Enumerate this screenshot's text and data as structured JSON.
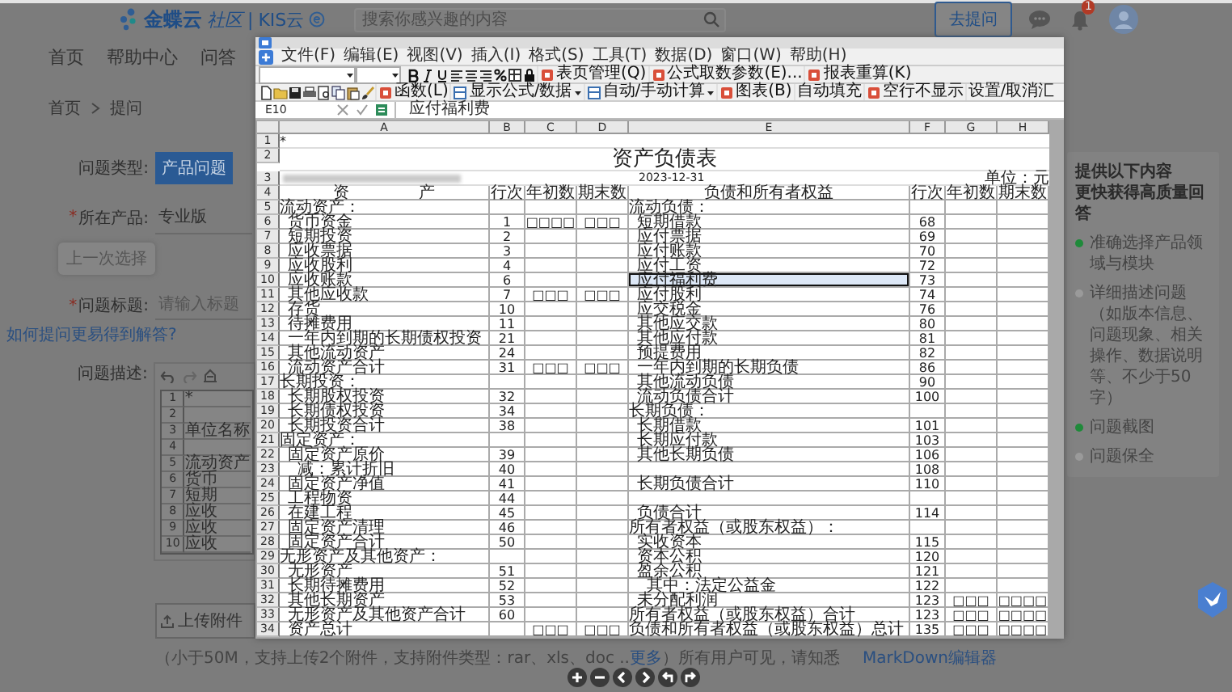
{
  "header": {
    "logo_brand": "金蝶云",
    "logo_community": "社区",
    "logo_divider": "|",
    "logo_product": "KIS云",
    "search": {
      "placeholder": "搜索你感兴趣的内容"
    },
    "ask_button": "去提问",
    "notification_count": "1"
  },
  "nav": [
    "首页",
    "帮助中心",
    "问答"
  ],
  "breadcrumb": [
    "首页",
    "提问"
  ],
  "form": {
    "question_type": {
      "label": "问题类型:",
      "options": [
        {
          "label": "产品问题",
          "selected": true
        }
      ]
    },
    "product": {
      "required_mark": "*",
      "label": "所在产品:",
      "value": "专业版",
      "tooltip": "上一次选择"
    },
    "title": {
      "required_mark": "*",
      "label": "问题标题:",
      "placeholder": "请输入标题"
    },
    "help_link": "如何提问更易得到解答?",
    "description": {
      "label": "问题描述:",
      "thumbnail_rows": [
        {
          "n": "1",
          "text": "*"
        },
        {
          "n": "2"
        },
        {
          "n": "3",
          "text": "单位名称"
        },
        {
          "n": "4"
        },
        {
          "n": "5",
          "text": "流动资产"
        },
        {
          "n": "6",
          "text": "货币"
        },
        {
          "n": "7",
          "text": "短期"
        },
        {
          "n": "8",
          "text": "应收"
        },
        {
          "n": "9",
          "text": "应收"
        },
        {
          "n": "10",
          "text": "应收"
        }
      ]
    },
    "upload_button": "上传附件",
    "note": {
      "before": "（小于50M，支持上传2个附件，支持附件类型：rar、xls、doc ..",
      "link": "更多",
      "after": "）所有用户可见，请知悉"
    },
    "markdown_link": "MarkDown编辑器"
  },
  "tips": {
    "title": [
      "提供以下内容",
      "更快获得高质量回答"
    ],
    "items": [
      {
        "text": "准确选择产品领域与模块",
        "done": true
      },
      {
        "text": "详细描述问题（如版本信息、问题现象、相关操作、数据说明等、不少于50字）",
        "done": false
      },
      {
        "text": "问题截图",
        "done": true
      },
      {
        "text": "问题保全",
        "done": false
      }
    ]
  },
  "viewer": {
    "menu": [
      "文件(F)",
      "编辑(E)",
      "视图(V)",
      "插入(I)",
      "格式(S)",
      "工具(T)",
      "数据(D)",
      "窗口(W)",
      "帮助(H)"
    ],
    "toolbar_1": [
      {
        "label": "表页管理(Q)",
        "kind": "icon-button"
      },
      {
        "label": "公式取数参数(E)...",
        "kind": "icon-button"
      },
      {
        "label": "报表重算(K)",
        "kind": "icon-button"
      }
    ],
    "toolbar_2": [
      {
        "label": "函数(L)",
        "kind": "icon-button"
      },
      {
        "label": "显示公式/数据",
        "kind": "icon-dropdown"
      },
      {
        "label": "自动/手动计算",
        "kind": "icon-dropdown"
      },
      {
        "label": "图表(B)",
        "kind": "icon-button"
      },
      {
        "label": "自动填充",
        "kind": "button"
      },
      {
        "label": "空行不显示",
        "kind": "icon-button"
      },
      {
        "label": "设置/取消汇",
        "kind": "button"
      }
    ],
    "cell_ref": "E10",
    "formula": "应付福利费",
    "sheet": {
      "columns": [
        "A",
        "B",
        "C",
        "D",
        "E",
        "F",
        "G",
        "H"
      ],
      "top_rows": [
        "1",
        "2",
        "3",
        "4"
      ],
      "marker": "*",
      "title": "资产负债表",
      "date": "2023-12-31",
      "unit": "单位：元",
      "headers": [
        "资 产",
        "行次",
        "年初数",
        "期末数",
        "负债和所有者权益",
        "行次",
        "年初数",
        "期末数"
      ],
      "rows": [
        {
          "n": "5",
          "left": {
            "text": "流动资产：",
            "kind": "section"
          },
          "right": {
            "text": "流动负债：",
            "kind": "section",
            "selected": false
          }
        },
        {
          "n": "6",
          "left": {
            "text": "货币资金",
            "kind": "item",
            "line": "1",
            "begin": "□□□□",
            "end": "□□□"
          },
          "right": {
            "text": "短期借款",
            "kind": "item",
            "line": "68",
            "selected": false
          }
        },
        {
          "n": "7",
          "left": {
            "text": "短期投资",
            "kind": "item",
            "line": "2"
          },
          "right": {
            "text": "应付票据",
            "kind": "item",
            "line": "69",
            "selected": false
          }
        },
        {
          "n": "8",
          "left": {
            "text": "应收票据",
            "kind": "item",
            "line": "3"
          },
          "right": {
            "text": "应付账款",
            "kind": "item",
            "line": "70",
            "selected": false
          }
        },
        {
          "n": "9",
          "left": {
            "text": "应收股利",
            "kind": "item",
            "line": "4"
          },
          "right": {
            "text": "应付工资",
            "kind": "item",
            "line": "72",
            "selected": false
          }
        },
        {
          "n": "10",
          "left": {
            "text": "应收账款",
            "kind": "item",
            "line": "6"
          },
          "right": {
            "text": "应付福利费",
            "kind": "item",
            "line": "73",
            "selected": true
          }
        },
        {
          "n": "11",
          "left": {
            "text": "其他应收款",
            "kind": "item",
            "line": "7",
            "begin": "□□□",
            "end": "□□□"
          },
          "right": {
            "text": "应付股利",
            "kind": "item",
            "line": "74",
            "selected": false
          }
        },
        {
          "n": "12",
          "left": {
            "text": "存货",
            "kind": "item",
            "line": "10"
          },
          "right": {
            "text": "应交税金",
            "kind": "item",
            "line": "76",
            "selected": false
          }
        },
        {
          "n": "13",
          "left": {
            "text": "待摊费用",
            "kind": "item",
            "line": "11"
          },
          "right": {
            "text": "其他应交款",
            "kind": "item",
            "line": "80",
            "selected": false
          }
        },
        {
          "n": "14",
          "left": {
            "text": "一年内到期的长期债权投资",
            "kind": "item",
            "line": "21"
          },
          "right": {
            "text": "其他应付款",
            "kind": "item",
            "line": "81",
            "selected": false
          }
        },
        {
          "n": "15",
          "left": {
            "text": "其他流动资产",
            "kind": "item",
            "line": "24"
          },
          "right": {
            "text": "预提费用",
            "kind": "item",
            "line": "82",
            "selected": false
          }
        },
        {
          "n": "16",
          "left": {
            "text": "流动资产合计",
            "kind": "item",
            "line": "31",
            "begin": "□□□",
            "end": "□□□"
          },
          "right": {
            "text": "一年内到期的长期负债",
            "kind": "item",
            "line": "86",
            "selected": false
          }
        },
        {
          "n": "17",
          "left": {
            "text": "长期投资：",
            "kind": "section"
          },
          "right": {
            "text": "其他流动负债",
            "kind": "item",
            "line": "90",
            "selected": false
          }
        },
        {
          "n": "18",
          "left": {
            "text": "长期股权投资",
            "kind": "item",
            "line": "32"
          },
          "right": {
            "text": "流动负债合计",
            "kind": "item",
            "line": "100",
            "selected": false
          }
        },
        {
          "n": "19",
          "left": {
            "text": "长期债权投资",
            "kind": "item",
            "line": "34"
          },
          "right": {
            "text": "长期负债：",
            "kind": "section",
            "selected": false
          }
        },
        {
          "n": "20",
          "left": {
            "text": "长期投资合计",
            "kind": "item",
            "line": "38"
          },
          "right": {
            "text": "长期借款",
            "kind": "item",
            "line": "101",
            "selected": false
          }
        },
        {
          "n": "21",
          "left": {
            "text": "固定资产：",
            "kind": "section"
          },
          "right": {
            "text": "长期应付款",
            "kind": "item",
            "line": "103",
            "selected": false
          }
        },
        {
          "n": "22",
          "left": {
            "text": "固定资产原价",
            "kind": "item",
            "line": "39"
          },
          "right": {
            "text": "其他长期负债",
            "kind": "item",
            "line": "106",
            "selected": false
          }
        },
        {
          "n": "23",
          "left": {
            "text": "减：累计折旧",
            "kind": "sub",
            "line": "40"
          },
          "right": {
            "line": "108",
            "selected": false
          }
        },
        {
          "n": "24",
          "left": {
            "text": "固定资产净值",
            "kind": "item",
            "line": "41"
          },
          "right": {
            "text": "长期负债合计",
            "kind": "item",
            "line": "110",
            "selected": false
          }
        },
        {
          "n": "25",
          "left": {
            "text": "工程物资",
            "kind": "item",
            "line": "44"
          },
          "right": {
            "selected": false
          }
        },
        {
          "n": "26",
          "left": {
            "text": "在建工程",
            "kind": "item",
            "line": "45"
          },
          "right": {
            "text": "负债合计",
            "kind": "item",
            "line": "114",
            "selected": false
          }
        },
        {
          "n": "27",
          "left": {
            "text": "固定资产清理",
            "kind": "item",
            "line": "46"
          },
          "right": {
            "text": "所有者权益（或股东权益）：",
            "kind": "section",
            "selected": false
          }
        },
        {
          "n": "28",
          "left": {
            "text": "固定资产合计",
            "kind": "item",
            "line": "50"
          },
          "right": {
            "text": "实收资本",
            "kind": "item",
            "line": "115",
            "selected": false
          }
        },
        {
          "n": "29",
          "left": {
            "text": "无形资产及其他资产：",
            "kind": "section"
          },
          "right": {
            "text": "资本公积",
            "kind": "item",
            "line": "120",
            "selected": false
          }
        },
        {
          "n": "30",
          "left": {
            "text": "无形资产",
            "kind": "item",
            "line": "51"
          },
          "right": {
            "text": "盈余公积",
            "kind": "item",
            "line": "121",
            "selected": false
          }
        },
        {
          "n": "31",
          "left": {
            "text": "长期待摊费用",
            "kind": "item",
            "line": "52"
          },
          "right": {
            "text": "其中：法定公益金",
            "kind": "sub",
            "line": "122",
            "selected": false
          }
        },
        {
          "n": "32",
          "left": {
            "text": "其他长期资产",
            "kind": "item",
            "line": "53"
          },
          "right": {
            "text": "未分配利润",
            "kind": "item",
            "line": "123",
            "begin": "□□□",
            "end": "□□□□",
            "selected": false
          }
        },
        {
          "n": "33",
          "left": {
            "text": "无形资产及其他资产合计",
            "kind": "item",
            "line": "60"
          },
          "right": {
            "text": "所有者权益（或股东权益）合计",
            "kind": "section",
            "line": "123",
            "begin": "□□□",
            "end": "□□□□",
            "selected": false
          }
        },
        {
          "n": "34",
          "left": {
            "text": "资产总计",
            "kind": "item",
            "begin": "□□□",
            "end": "□□□"
          },
          "right": {
            "text": "负债和所有者权益（或股东权益）总计",
            "kind": "section",
            "line": "135",
            "begin": "□□□",
            "end": "□□□□",
            "selected": false
          }
        }
      ]
    }
  }
}
